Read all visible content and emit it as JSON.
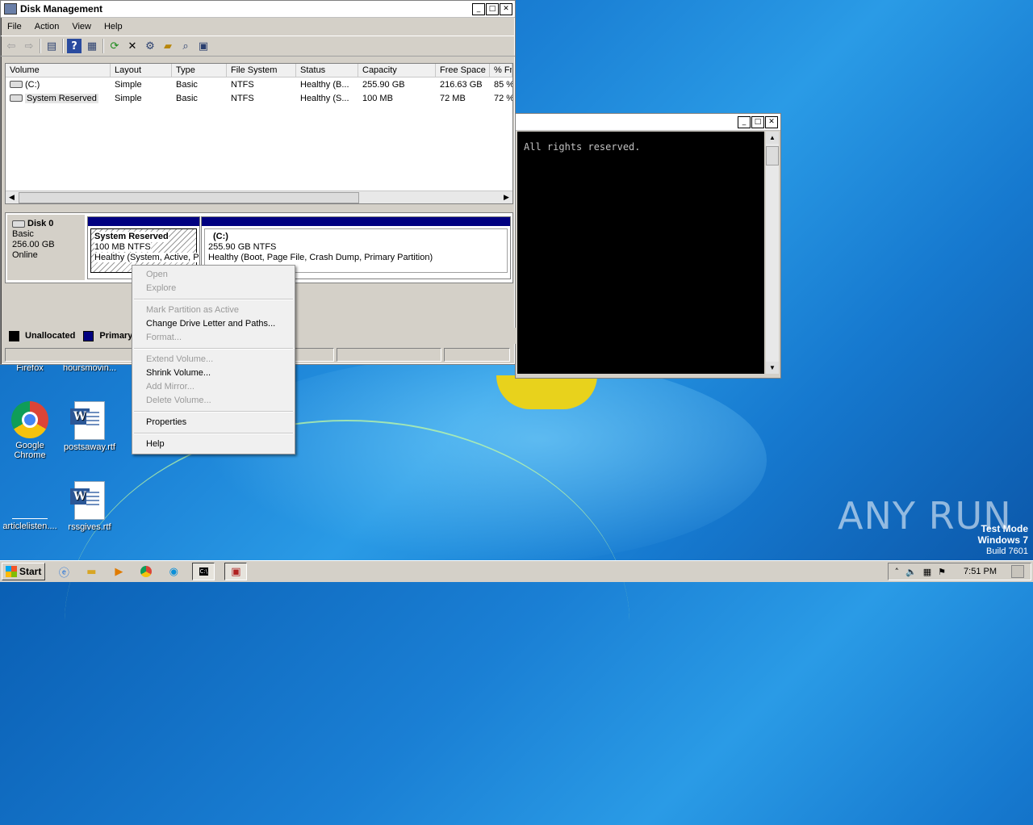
{
  "desktop": {
    "icons": [
      {
        "label": "Firefox"
      },
      {
        "label": "hoursmovin..."
      },
      {
        "label": "Google Chrome"
      },
      {
        "label": "postsaway.rtf"
      },
      {
        "label": "articlelisten...."
      },
      {
        "label": "rssgives.rtf"
      }
    ],
    "watermark": "ANY RUN",
    "test_mode": {
      "line1": "Test Mode",
      "line2": "Windows 7",
      "line3": "Build 7601"
    }
  },
  "disk_management": {
    "title": "Disk Management",
    "menu": [
      "File",
      "Action",
      "View",
      "Help"
    ],
    "toolbar_icons": [
      "back-icon",
      "forward-icon",
      "show-hide-console-tree-icon",
      "help-icon",
      "properties-icon",
      "refresh-icon",
      "delete-icon",
      "settings-icon",
      "open-folder-icon",
      "search-icon",
      "export-icon"
    ],
    "columns": [
      "Volume",
      "Layout",
      "Type",
      "File System",
      "Status",
      "Capacity",
      "Free Space",
      "% Fr"
    ],
    "volumes": [
      {
        "volume": "(C:)",
        "layout": "Simple",
        "type": "Basic",
        "fs": "NTFS",
        "status": "Healthy (B...",
        "capacity": "255.90 GB",
        "free": "216.63 GB",
        "pct": "85 %"
      },
      {
        "volume": "System Reserved",
        "layout": "Simple",
        "type": "Basic",
        "fs": "NTFS",
        "status": "Healthy (S...",
        "capacity": "100 MB",
        "free": "72 MB",
        "pct": "72 %"
      }
    ],
    "disk": {
      "name": "Disk 0",
      "type": "Basic",
      "size": "256.00 GB",
      "state": "Online"
    },
    "partitions": [
      {
        "name": "System Reserved",
        "size": "100 MB NTFS",
        "status": "Healthy (System, Active, P"
      },
      {
        "name": "(C:)",
        "size": "255.90 GB NTFS",
        "status": "Healthy (Boot, Page File, Crash Dump, Primary Partition)"
      }
    ],
    "legend": {
      "unallocated": "Unallocated",
      "primary": "Primary"
    }
  },
  "context_menu": {
    "items": [
      {
        "label": "Open",
        "enabled": false
      },
      {
        "label": "Explore",
        "enabled": false
      },
      {
        "label": "Mark Partition as Active",
        "enabled": false
      },
      {
        "label": "Change Drive Letter and Paths...",
        "enabled": true
      },
      {
        "label": "Format...",
        "enabled": false
      },
      {
        "label": "Extend Volume...",
        "enabled": false
      },
      {
        "label": "Shrink Volume...",
        "enabled": true
      },
      {
        "label": "Add Mirror...",
        "enabled": false
      },
      {
        "label": "Delete Volume...",
        "enabled": false
      },
      {
        "label": "Properties",
        "enabled": true
      },
      {
        "label": "Help",
        "enabled": true
      }
    ]
  },
  "console": {
    "text": "All rights reserved."
  },
  "taskbar": {
    "start_label": "Start",
    "clock": "7:51 PM"
  },
  "colors": {
    "primary_partition": "#000080",
    "title_accent": "#000080",
    "desktop_blue": "#1a7fd4"
  }
}
